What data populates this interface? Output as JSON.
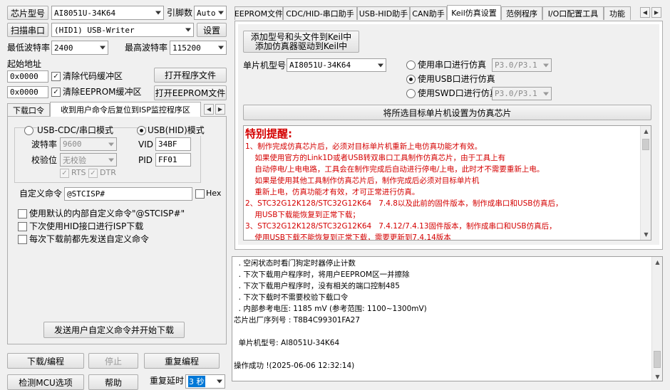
{
  "left": {
    "chip_model_label": "芯片型号",
    "chip_model_value": "AI8051U-34K64",
    "pins_label": "引脚数",
    "pins_value": "Auto",
    "scan_port_button": "扫描串口",
    "port_value": "(HID1) USB-Writer",
    "settings_button": "设置",
    "min_baud_label": "最低波特率",
    "min_baud_value": "2400",
    "max_baud_label": "最高波特率",
    "max_baud_value": "115200",
    "start_addr_label": "起始地址",
    "code_addr_value": "0x0000",
    "clear_code_label": "清除代码缓冲区",
    "open_program_button": "打开程序文件",
    "eeprom_addr_value": "0x0000",
    "clear_eeprom_label": "清除EEPROM缓冲区",
    "open_eeprom_button": "打开EEPROM文件"
  },
  "left_tabs": {
    "download_tab": "下载口令",
    "reset_tab": "收到用户命令后复位到ISP监控程序区"
  },
  "isp_panel": {
    "usb_cdc_mode": "USB-CDC/串口模式",
    "usb_hid_mode": "USB(HID)模式",
    "baud_label": "波特率",
    "baud_value": "9600",
    "parity_label": "校验位",
    "parity_value": "无校验",
    "rts_label": "RTS",
    "dtr_label": "DTR",
    "vid_label": "VID",
    "vid_value": "34BF",
    "pid_label": "PID",
    "pid_value": "FF01",
    "custom_cmd_label": "自定义命令",
    "custom_cmd_value": "@STCISP#",
    "hex_label": "Hex",
    "opt_default_cmd": "使用默认的内部自定义命令\"@STCISP#\"",
    "opt_hid_next": "下次使用HID接口进行ISP下载",
    "opt_send_before": "每次下载前都先发送自定义命令",
    "send_cmd_button": "发送用户自定义命令并开始下载"
  },
  "bottom_buttons": {
    "download": "下载/编程",
    "stop": "停止",
    "reprogram": "重复编程",
    "check_mcu": "检测MCU选项",
    "help": "帮助",
    "repeat_delay_label": "重复延时",
    "repeat_delay_value": "3 秒"
  },
  "right_tabs": [
    "EEPROM文件",
    "CDC/HID-串口助手",
    "USB-HID助手",
    "CAN助手",
    "Keil仿真设置",
    "范例程序",
    "I/O口配置工具",
    "功能"
  ],
  "keil": {
    "add_button_line1": "添加型号和头文件到Keil中",
    "add_button_line2": "添加仿真器驱动到Keil中",
    "mcu_model_label": "单片机型号",
    "mcu_model_value": "AI8051U-34K64",
    "sim_serial_label": "使用串口进行仿真",
    "sim_serial_port": "P3.0/P3.1",
    "sim_usb_label": "使用USB口进行仿真",
    "sim_swd_label": "使用SWD口进行仿真",
    "sim_swd_port": "P3.0/P3.1",
    "set_chip_button": "将所选目标单片机设置为仿真芯片",
    "notice_title": "特别提醒:",
    "notice_lines": [
      "1、制作完成仿真芯片后，必须对目标单片机重新上电仿真功能才有效。",
      "    如果使用官方的Link1D或者USB转双串口工具制作仿真芯片，由于工具上有",
      "    自动停电/上电电路，工具会在制作完成后自动进行停电/上电，此时才不需要重新上电。",
      "    如果是使用其他工具制作仿真芯片后，制作完成后必须对目标单片机",
      "    重新上电，仿真功能才有效，才可正常进行仿真。",
      "2、STC32G12K128/STC32G12K64   7.4.8以及此前的固件版本，制作成串口和USB仿真后，",
      "    用USB下载能恢复到正常下载；",
      "3、STC32G12K128/STC32G12K64   7.4.12/7.4.13固件版本，制作成串口和USB仿真后，",
      "    使用USB下载不能恢复到正常下载，需要更新到7.4.14版本"
    ]
  },
  "log": {
    "lines": [
      "  . 空闲状态时看门狗定时器停止计数",
      "  . 下次下载用户程序时，将用户EEPROM区一并擦除",
      "  . 下次下载用户程序时，没有相关的端口控制485",
      "  . 下次下载时不需要校验下载口令",
      "  . 内部参考电压: 1185 mV (参考范围: 1100~1300mV)",
      "芯片出厂序列号 : T8B4C99301FA27",
      "",
      "  单片机型号: AI8051U-34K64",
      "",
      "操作成功 !(2025-06-06 12:32:14)"
    ]
  },
  "colors": {
    "notice_red": "#d40000",
    "selection_blue": "#0078d7"
  }
}
